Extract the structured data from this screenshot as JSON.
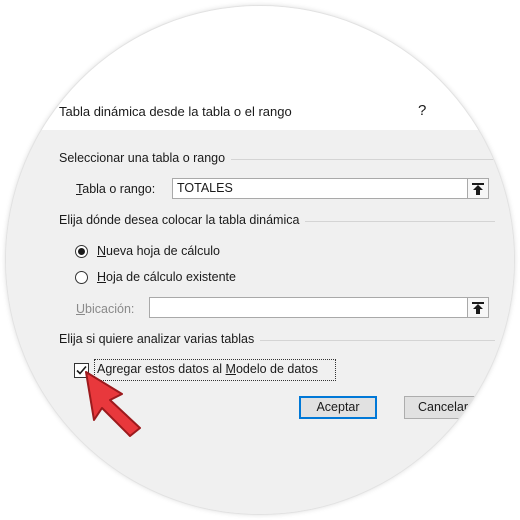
{
  "dialog": {
    "title": "Tabla dinámica desde la tabla o el rango",
    "help_symbol": "?"
  },
  "select_table": {
    "group_label": "Seleccionar una tabla o rango",
    "range_label_mnemonic": "T",
    "range_label_rest": "abla o rango:",
    "range_value": "TOTALES"
  },
  "placement": {
    "group_label": "Elija dónde desea colocar la tabla dinámica",
    "new_sheet_mnemonic": "N",
    "new_sheet_rest": "ueva hoja de cálculo",
    "new_sheet_selected": true,
    "existing_sheet_mnemonic": "H",
    "existing_sheet_rest": "oja de cálculo existente",
    "existing_sheet_selected": false,
    "location_label_mnemonic": "U",
    "location_label_rest": "bicación:",
    "location_value": ""
  },
  "multiple_tables": {
    "group_label": "Elija si quiere analizar varias tablas",
    "data_model_label_before": "Agregar estos datos al ",
    "data_model_label_mnemonic": "M",
    "data_model_label_after": "odelo de datos",
    "data_model_checked": true
  },
  "buttons": {
    "accept": "Aceptar",
    "cancel": "Cancelar"
  },
  "colors": {
    "dialog_bg": "#f0f0f0",
    "accent_button_border": "#0078d7",
    "annotation_arrow": "#e8383c"
  },
  "icons": {
    "range_collapse": "range-collapse-icon",
    "annotation": "red-pointer-arrow-icon"
  }
}
